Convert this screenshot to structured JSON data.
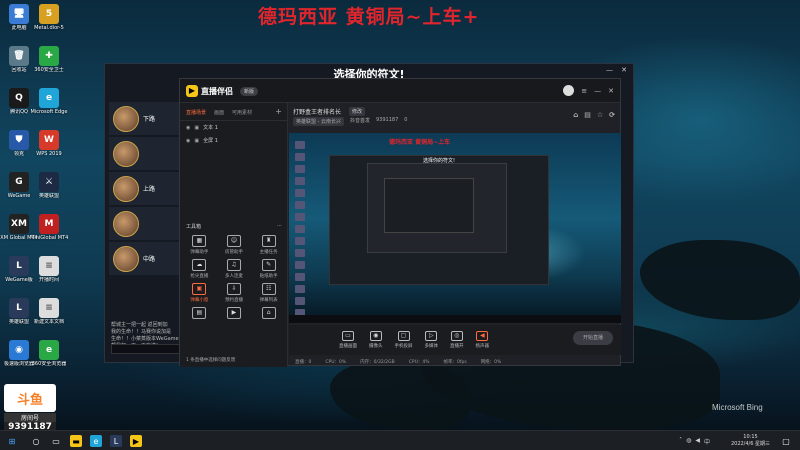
{
  "overlay_title": "德玛西亚 黄铜局~上车+",
  "desktop_icons": [
    {
      "label": "此电脑",
      "glyph": "🖥",
      "color": "#3a7bd5"
    },
    {
      "label": "Metal.dior-5",
      "glyph": "5",
      "color": "#d8a020"
    },
    {
      "label": "回收站",
      "glyph": "🗑",
      "color": "#5a7a8a"
    },
    {
      "label": "360安全卫士",
      "glyph": "✚",
      "color": "#2aa845"
    },
    {
      "label": "腾讯QQ",
      "glyph": "Q",
      "color": "#1a1a1a"
    },
    {
      "label": "Microsoft Edge",
      "glyph": "e",
      "color": "#1fa5d8"
    },
    {
      "label": "领克",
      "glyph": "⛊",
      "color": "#2858a8"
    },
    {
      "label": "WPS 2019",
      "glyph": "W",
      "color": "#d83a2a"
    },
    {
      "label": "WeGame",
      "glyph": "G",
      "color": "#222222"
    },
    {
      "label": "英雄联盟",
      "glyph": "⚔",
      "color": "#1c2a44"
    },
    {
      "label": "XM Global MT4",
      "glyph": "XM",
      "color": "#222222"
    },
    {
      "label": "MiniGlobal MT4",
      "glyph": "M",
      "color": "#c02020"
    },
    {
      "label": "WeGame版",
      "glyph": "L",
      "color": "#2a3a5a"
    },
    {
      "label": "开播时间",
      "glyph": "≡",
      "color": "#dddddd"
    },
    {
      "label": "英雄联盟",
      "glyph": "L",
      "color": "#2a3a5a"
    },
    {
      "label": "新建文本文档",
      "glyph": "≡",
      "color": "#dddddd"
    },
    {
      "label": "极速版浏览器",
      "glyph": "◉",
      "color": "#2a7ad5"
    },
    {
      "label": "360安全浏览器",
      "glyph": "e",
      "color": "#2aa845"
    }
  ],
  "douyu": {
    "logo": "斗鱼",
    "room_label": "房间号",
    "room_number": "9391187"
  },
  "game_window": {
    "title": "选择你的符文!",
    "champions": [
      {
        "name": "下路"
      },
      {
        "name": ""
      },
      {
        "name": "上路"
      },
      {
        "name": ""
      },
      {
        "name": "中路"
      }
    ],
    "chat_lines": [
      "帮城主一把一起 返回到加",
      "我的生命！！马赛你说加是",
      "生命！！小菜蒸版本WeGame",
      "帮我加一下，正在进!"
    ]
  },
  "app": {
    "brand": "直播伴侣",
    "version_tag": "新版",
    "sidebar": {
      "tabs": [
        "直播场景",
        "画面",
        "可用素材"
      ],
      "sources": [
        {
          "label": "文本 1"
        },
        {
          "label": "全屏 1"
        }
      ],
      "tools_title": "工具箱",
      "tools": [
        {
          "icon": "▦",
          "label": "弹幕助手",
          "hot": false
        },
        {
          "icon": "☺",
          "label": "房管助手",
          "hot": false
        },
        {
          "icon": "♜",
          "label": "主播任务",
          "hot": false
        },
        {
          "icon": "☁",
          "label": "抢尖直播",
          "hot": false
        },
        {
          "icon": "♫",
          "label": "多人连麦",
          "hot": false
        },
        {
          "icon": "✎",
          "label": "贴纸助手",
          "hot": false
        },
        {
          "icon": "▣",
          "label": "弹幕小窗",
          "hot": true
        },
        {
          "icon": "⇩",
          "label": "预约直播",
          "hot": false
        },
        {
          "icon": "☷",
          "label": "弹幕列表",
          "hot": false
        },
        {
          "icon": "▤",
          "label": "",
          "hot": false
        },
        {
          "icon": "▶",
          "label": "",
          "hot": false
        },
        {
          "icon": "⌂",
          "label": "",
          "hot": false
        }
      ],
      "footer": "1 条直播中选择问题反馈"
    },
    "main": {
      "room_title": "打野盒王者排名长",
      "room_chip": "修改",
      "room_sub": [
        "英雄联盟 - 云南长兴",
        "抖音首发",
        "9391187",
        "0"
      ],
      "header_icons": [
        {
          "icon": "⌂",
          "label": ""
        },
        {
          "icon": "▤",
          "label": ""
        },
        {
          "icon": "☆",
          "label": ""
        },
        {
          "icon": "⟳",
          "label": ""
        }
      ]
    },
    "preview": {
      "overlay": "德玛西亚 黄铜局~上车",
      "inner_title": "选择你的符文!"
    },
    "controls": [
      {
        "icon": "▭",
        "label": "直播画面",
        "red": false
      },
      {
        "icon": "◉",
        "label": "摄像头",
        "red": false
      },
      {
        "icon": "▢",
        "label": "手机投屏",
        "red": false
      },
      {
        "icon": "▷",
        "label": "多媒体",
        "red": false
      },
      {
        "icon": "◎",
        "label": "直播开",
        "red": false
      },
      {
        "icon": "◀",
        "label": "扬声器",
        "red": true
      }
    ],
    "start_label": "开始直播",
    "statusbar": [
      "直播：0",
      "CPU：0%",
      "内存：0/32/2GB",
      "CPU：4%",
      "帧率：0fps",
      "网络：0%"
    ]
  },
  "taskbar": {
    "time": "10:15",
    "date": "2022/4/6 星期三"
  },
  "watermark": "Microsoft Bing"
}
